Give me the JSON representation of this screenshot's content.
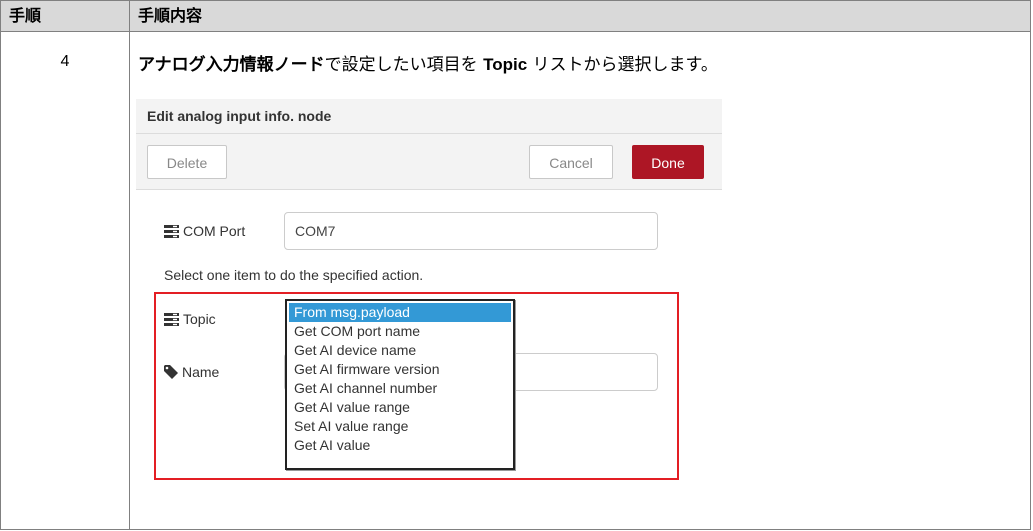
{
  "table": {
    "header": {
      "step": "手順",
      "content": "手順内容"
    },
    "row": {
      "step_number": "4",
      "instruction": {
        "node_name": "アナログ入力情報ノード",
        "part1": "で設定したい項目を ",
        "topic_word": "Topic",
        "part2": " リストから選択します。"
      }
    }
  },
  "dialog": {
    "title": "Edit analog input info. node",
    "buttons": {
      "delete": "Delete",
      "cancel": "Cancel",
      "done": "Done"
    },
    "com_port": {
      "label": "COM Port",
      "value": "COM7"
    },
    "help_text": "Select one item to do the specified action.",
    "topic": {
      "label": "Topic",
      "options": [
        "From msg.payload",
        "Get COM port name",
        "Get AI device name",
        "Get AI firmware version",
        "Get AI channel number",
        "Get AI value range",
        "Set AI value range",
        "Get AI value"
      ],
      "selected": "From msg.payload"
    },
    "name": {
      "label": "Name",
      "value": ""
    }
  },
  "colors": {
    "highlight": "#e31e24",
    "done_button": "#ad1625",
    "selected_option": "#3399d6",
    "header_bg": "#d9d9d9"
  }
}
